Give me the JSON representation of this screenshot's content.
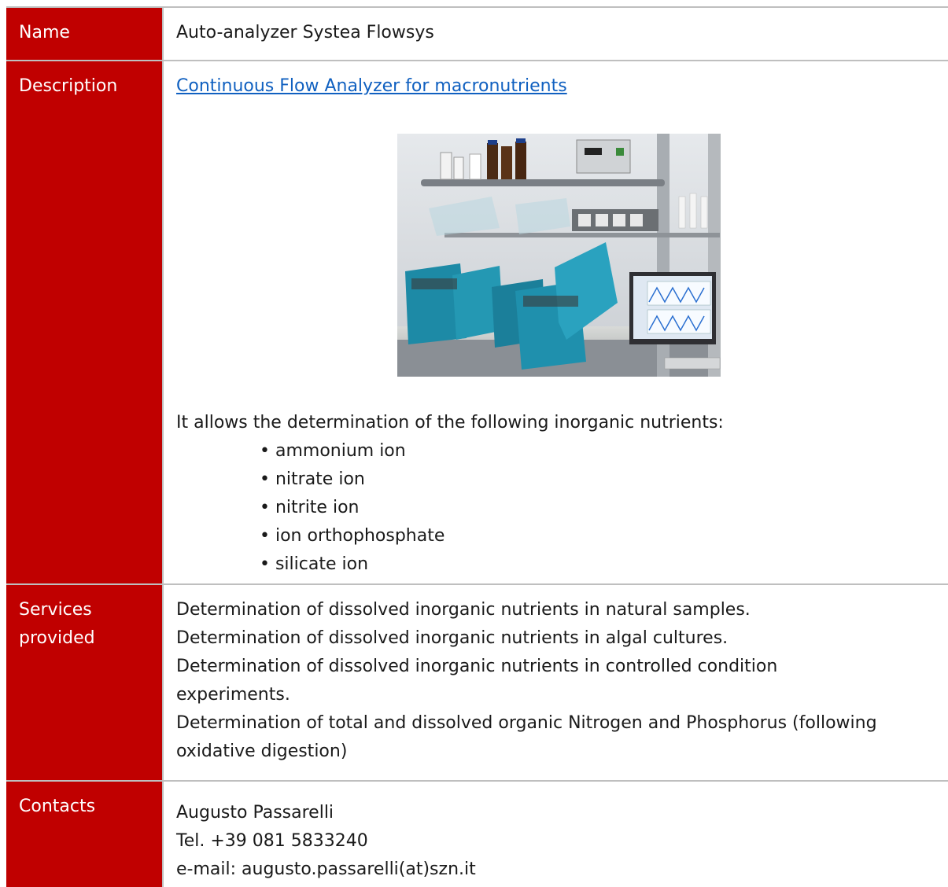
{
  "rows": {
    "name": {
      "label": "Name",
      "value": "Auto-analyzer Systea Flowsys"
    },
    "description": {
      "label": "Description",
      "link": "Continuous Flow Analyzer for macronutrients",
      "intro": "It allows the determination of the following inorganic nutrients:",
      "items": [
        "• ammonium ion",
        "• nitrate ion",
        "• nitrite ion",
        "• ion orthophosphate",
        "• silicate ion"
      ]
    },
    "services": {
      "label_line1": "Services",
      "label_line2": "provided",
      "lines": [
        "Determination of dissolved inorganic nutrients in natural samples.",
        "Determination of dissolved inorganic nutrients in algal cultures.",
        "Determination of dissolved inorganic nutrients in controlled condition",
        "experiments.",
        "Determination of total and dissolved organic Nitrogen and Phosphorus (following",
        "oxidative digestion)"
      ]
    },
    "contacts": {
      "label": "Contacts",
      "lines": [
        "Augusto Passarelli",
        "Tel. +39  081 5833240",
        "e-mail: augusto.passarelli(at)szn.it"
      ]
    }
  },
  "colors": {
    "label_bg": "#c00000",
    "border": "#bfbfbf",
    "link": "#1060c0"
  }
}
